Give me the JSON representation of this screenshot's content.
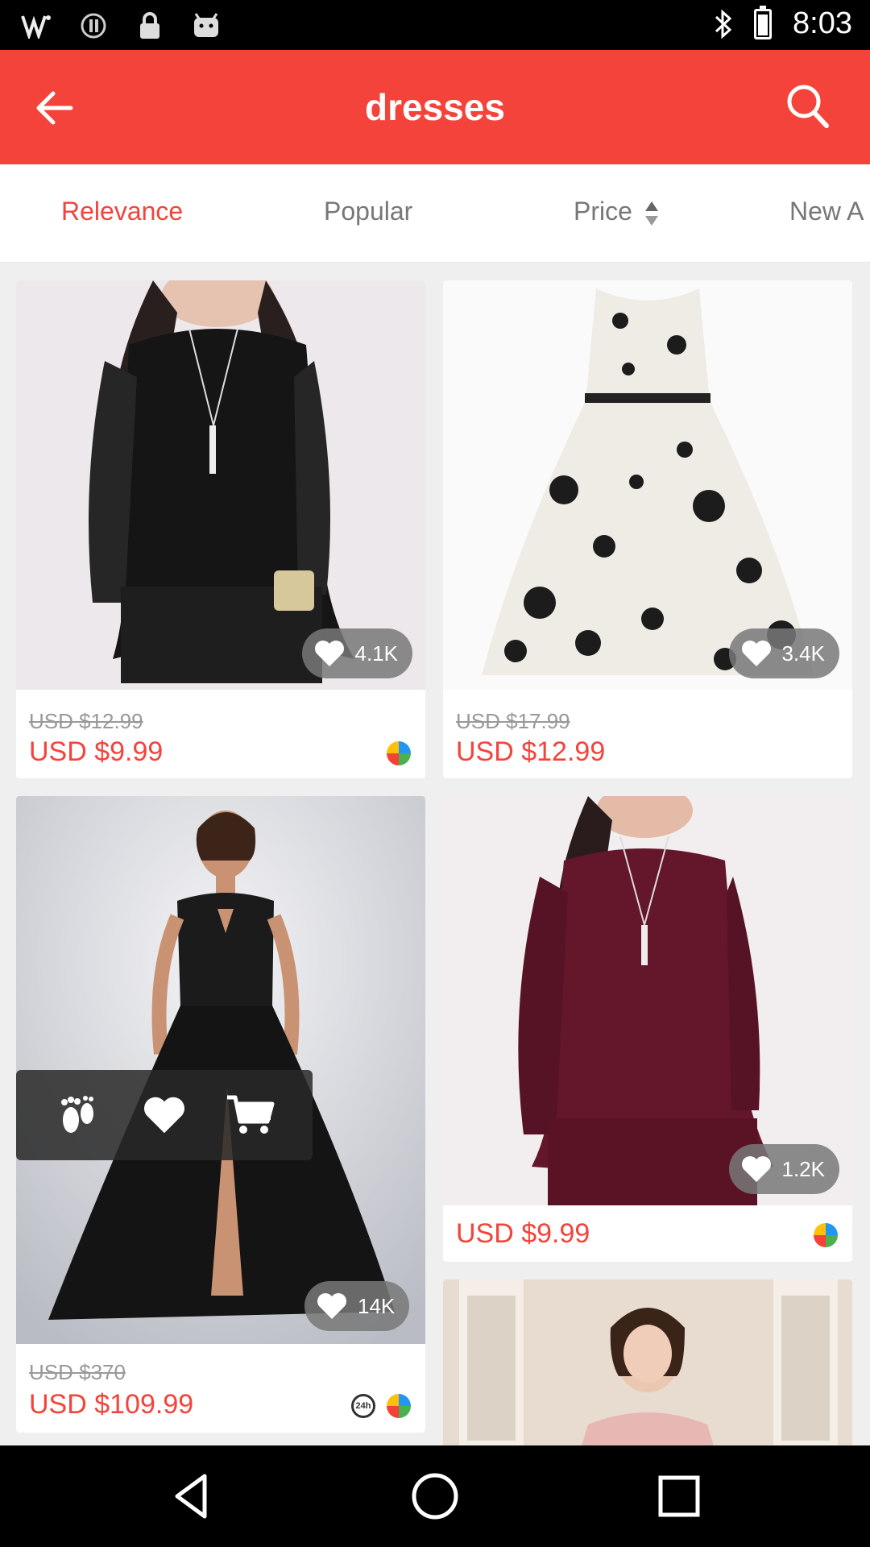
{
  "status_bar": {
    "time": "8:03",
    "icons": [
      "wifi-icon",
      "blocked-icon",
      "lock-icon",
      "android-icon",
      "bluetooth-icon",
      "battery-icon"
    ]
  },
  "header": {
    "title": "dresses",
    "back_icon": "arrow-left-icon",
    "search_icon": "search-icon",
    "color": "#f4433a"
  },
  "sort_tabs": [
    {
      "label": "Relevance",
      "active": true
    },
    {
      "label": "Popular",
      "active": false
    },
    {
      "label": "Price",
      "active": false
    },
    {
      "label": "New A",
      "active": false
    }
  ],
  "products": [
    {
      "name": "black-lace-dress",
      "likes": "4.1K",
      "old_price": "USD $12.99",
      "price": "USD $9.99"
    },
    {
      "name": "floral-white-dress",
      "likes": "3.4K",
      "old_price": "USD $17.99",
      "price": "USD $12.99"
    },
    {
      "name": "black-evening-gown",
      "likes": "14K",
      "old_price": "USD $370",
      "price": "USD $109.99"
    },
    {
      "name": "burgundy-lace-dress",
      "likes": "1.2K",
      "old_price": "",
      "price": "USD $9.99"
    },
    {
      "name": "pink-lace-dress"
    }
  ],
  "floating_bar": {
    "icons": [
      "footprints-icon",
      "heart-icon",
      "cart-icon"
    ]
  },
  "nav_bar": {
    "icons": [
      "back-triangle-icon",
      "home-circle-icon",
      "recents-square-icon"
    ]
  }
}
